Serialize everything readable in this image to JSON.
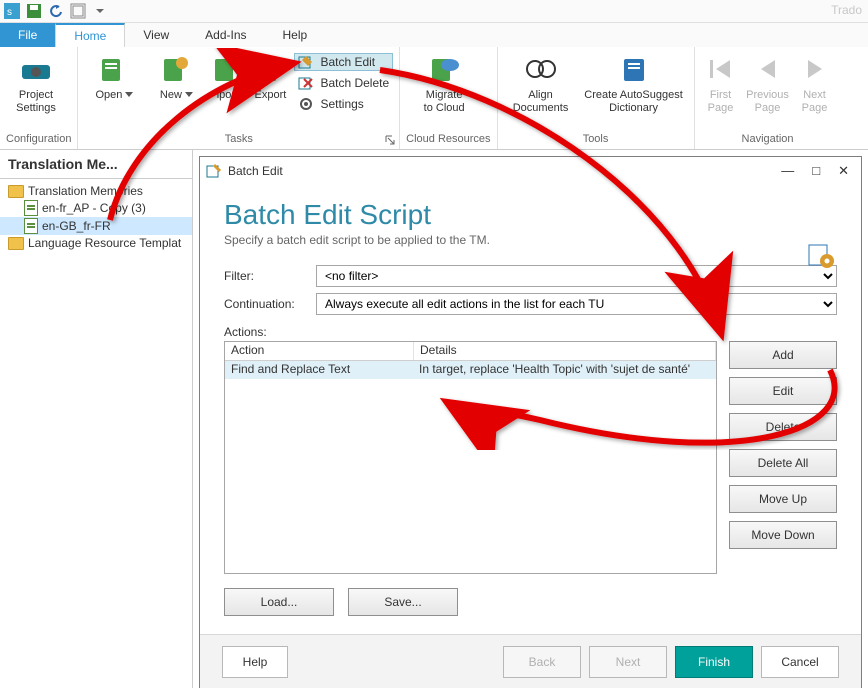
{
  "qat_brand": "Trado",
  "tabs": {
    "file": "File",
    "home": "Home",
    "view": "View",
    "addins": "Add-Ins",
    "help": "Help"
  },
  "ribbon": {
    "config": {
      "project_settings": "Project\nSettings",
      "label": "Configuration"
    },
    "tasks": {
      "open": "Open",
      "new": "New",
      "import": "iport",
      "export": "Export",
      "batch_edit": "Batch Edit",
      "batch_delete": "Batch Delete",
      "settings": "Settings",
      "label": "Tasks"
    },
    "cloud": {
      "migrate": "Migrate\nto Cloud",
      "label": "Cloud Resources"
    },
    "tools": {
      "align": "Align\nDocuments",
      "autosuggest": "Create AutoSuggest\nDictionary",
      "label": "Tools"
    },
    "nav": {
      "first": "First\nPage",
      "prev": "Previous\nPage",
      "next": "Next\nPage",
      "label": "Navigation"
    }
  },
  "panel": {
    "title": "Translation  Me...",
    "root": "Translation Memories",
    "tm1": "en-fr_AP - Copy (3)",
    "tm2": "en-GB_fr-FR",
    "lang_root": "Language Resource Templat"
  },
  "dialog": {
    "title": "Batch Edit",
    "heading": "Batch Edit Script",
    "sub": "Specify a batch edit script to be applied to the TM.",
    "filter_label": "Filter:",
    "filter_value": "<no filter>",
    "cont_label": "Continuation:",
    "cont_value": "Always execute all edit actions in the list for each TU",
    "actions_label": "Actions:",
    "col_action": "Action",
    "col_details": "Details",
    "row_action": "Find and Replace Text",
    "row_details": "In target, replace 'Health Topic' with 'sujet de santé'",
    "btn_add": "Add",
    "btn_edit": "Edit",
    "btn_delete": "Delete",
    "btn_delete_all": "Delete All",
    "btn_moveup": "Move Up",
    "btn_movedown": "Move Down",
    "btn_load": "Load...",
    "btn_save": "Save...",
    "btn_help": "Help",
    "btn_back": "Back",
    "btn_next": "Next",
    "btn_finish": "Finish",
    "btn_cancel": "Cancel"
  }
}
